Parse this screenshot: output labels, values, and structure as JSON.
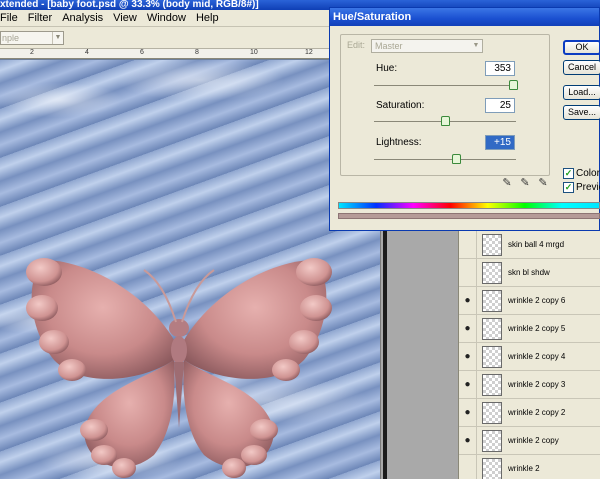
{
  "app": {
    "title_text": "xtended - [baby foot.psd @ 33.3% (body mid, RGB/8#)]"
  },
  "menu": [
    "File",
    "Filter",
    "Analysis",
    "View",
    "Window",
    "Help"
  ],
  "options_bar": {
    "style_value": "nple"
  },
  "ruler": {
    "ticks": [
      "2",
      "4",
      "6",
      "8",
      "10",
      "12"
    ]
  },
  "dialog": {
    "title": "Hue/Saturation",
    "edit_label": "Edit:",
    "edit_value": "Master",
    "hue": {
      "label": "Hue:",
      "value": "353",
      "level": 0.98
    },
    "saturation": {
      "label": "Saturation:",
      "value": "25",
      "level": 0.5
    },
    "lightness": {
      "label": "Lightness:",
      "value": "+15",
      "level": 0.58
    },
    "buttons": {
      "ok": "OK",
      "cancel": "Cancel",
      "load": "Load...",
      "save": "Save..."
    },
    "colorize": {
      "label": "Colorize",
      "checked": true
    },
    "preview": {
      "label": "Preview",
      "checked": true
    },
    "colors": {
      "colorized_bar": "#b59b98"
    }
  },
  "layers": [
    {
      "name": "skin ball 4 mrgd",
      "visible": false
    },
    {
      "name": "skn bl shdw",
      "visible": false
    },
    {
      "name": "wrinkle 2 copy 6",
      "visible": true
    },
    {
      "name": "wrinkle 2 copy 5",
      "visible": true
    },
    {
      "name": "wrinkle 2 copy 4",
      "visible": true
    },
    {
      "name": "wrinkle 2 copy 3",
      "visible": true
    },
    {
      "name": "wrinkle 2 copy 2",
      "visible": true
    },
    {
      "name": "wrinkle 2 copy",
      "visible": true
    },
    {
      "name": "wrinkle 2",
      "visible": false
    }
  ]
}
